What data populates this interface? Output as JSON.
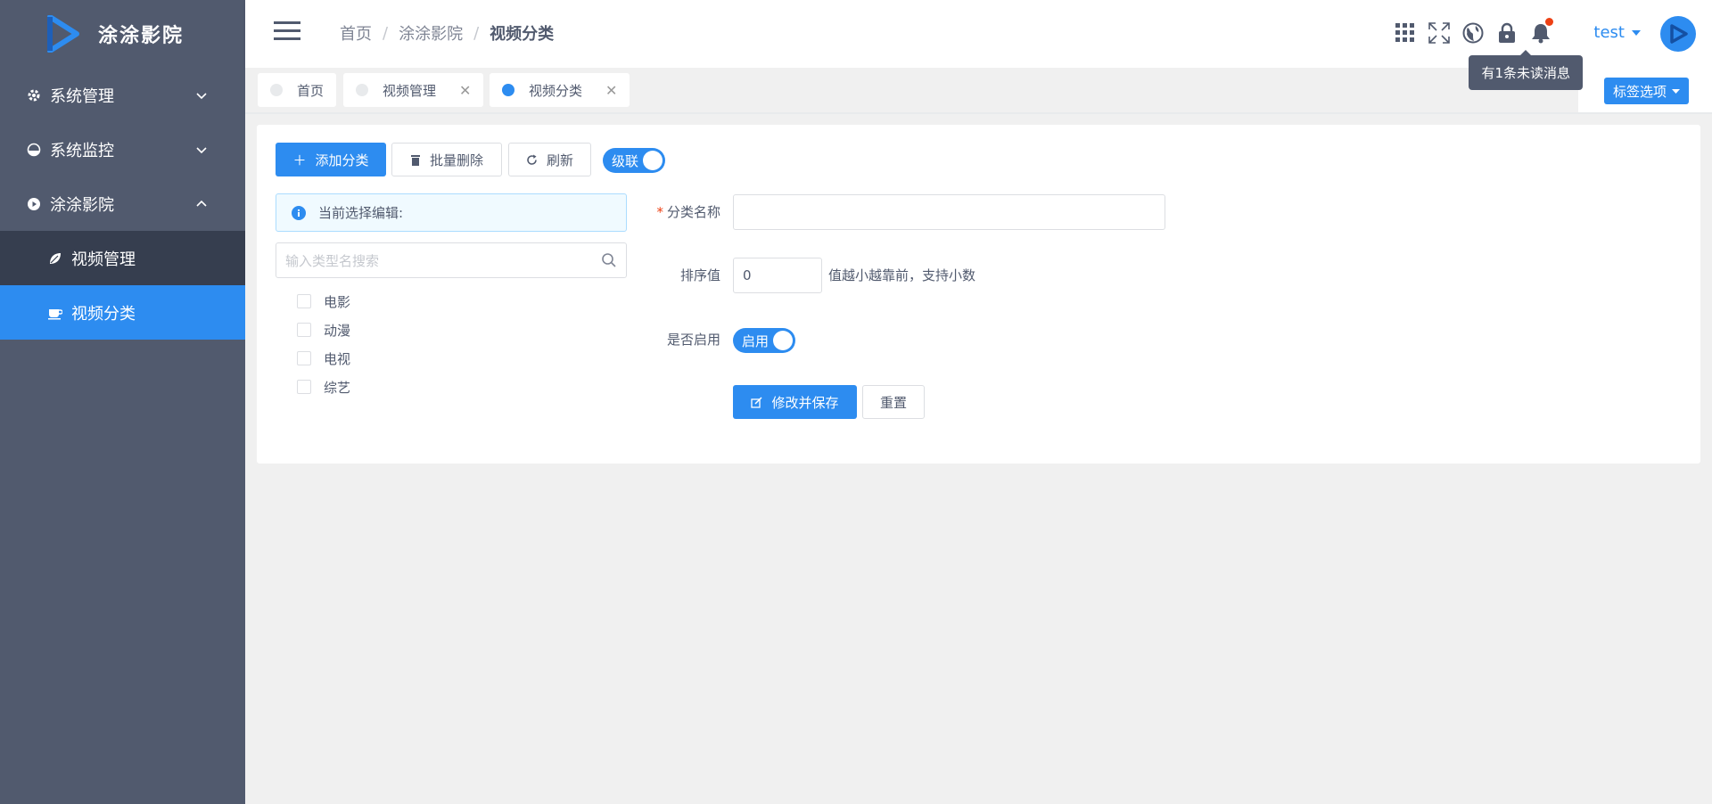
{
  "app": {
    "name": "涂涂影院"
  },
  "sidebar": {
    "items": [
      {
        "label": "系统管理",
        "icon": "gear-icon",
        "expanded": false
      },
      {
        "label": "系统监控",
        "icon": "gauge-icon",
        "expanded": false
      },
      {
        "label": "涂涂影院",
        "icon": "play-circle-icon",
        "expanded": true
      }
    ],
    "submenu": [
      {
        "label": "视频管理",
        "icon": "leaf-icon"
      },
      {
        "label": "视频分类",
        "icon": "cup-icon",
        "active": true
      }
    ]
  },
  "header": {
    "breadcrumb": [
      "首页",
      "涂涂影院",
      "视频分类"
    ],
    "username": "test",
    "tooltip": "有1条未读消息"
  },
  "tags": {
    "items": [
      "首页",
      "视频管理",
      "视频分类"
    ],
    "options_label": "标签选项"
  },
  "toolbar": {
    "add_label": "添加分类",
    "batch_delete_label": "批量删除",
    "refresh_label": "刷新",
    "cascade_label": "级联"
  },
  "tree": {
    "alert": "当前选择编辑:",
    "search_placeholder": "输入类型名搜索",
    "items": [
      "电影",
      "动漫",
      "电视",
      "综艺"
    ]
  },
  "form": {
    "name_label": "分类名称",
    "name_value": "",
    "sort_label": "排序值",
    "sort_value": "0",
    "sort_hint": "值越小越靠前，支持小数",
    "enable_label": "是否启用",
    "enable_switch": "启用",
    "save_label": "修改并保存",
    "reset_label": "重置"
  },
  "colors": {
    "primary": "#2d8cf0",
    "sidebar": "#515a6e",
    "submenu": "#363e4f",
    "badge": "#ed4014"
  }
}
